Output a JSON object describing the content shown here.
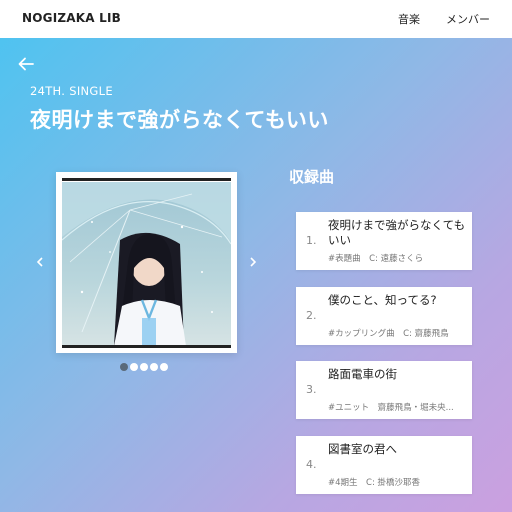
{
  "header": {
    "brand": "NOGIZAKA LIB",
    "nav": [
      "音楽",
      "メンバー"
    ]
  },
  "single": {
    "label": "24TH. SINGLE",
    "title": "夜明けまで強がらなくてもいい"
  },
  "carousel": {
    "dots": 5,
    "active_index": 0
  },
  "tracks": {
    "heading": "収録曲",
    "items": [
      {
        "number": "1.",
        "title": "夜明けまで強がらなくてもいい",
        "meta": "#表題曲　C: 遠藤さくら"
      },
      {
        "number": "2.",
        "title": "僕のこと、知ってる?",
        "meta": "#カップリング曲　C: 齋藤飛鳥"
      },
      {
        "number": "3.",
        "title": "路面電車の街",
        "meta": "#ユニット　齋藤飛鳥・堀未央..."
      },
      {
        "number": "4.",
        "title": "図書室の君へ",
        "meta": "#4期生　C: 掛橋沙耶香"
      }
    ]
  },
  "colors": {
    "gradient_start": "#4fc3f0",
    "gradient_end": "#cba0e0",
    "active_dot": "#5a6a7a"
  },
  "icons": {
    "back": "arrow-left-icon",
    "prev": "chevron-left-icon",
    "next": "chevron-right-icon"
  }
}
